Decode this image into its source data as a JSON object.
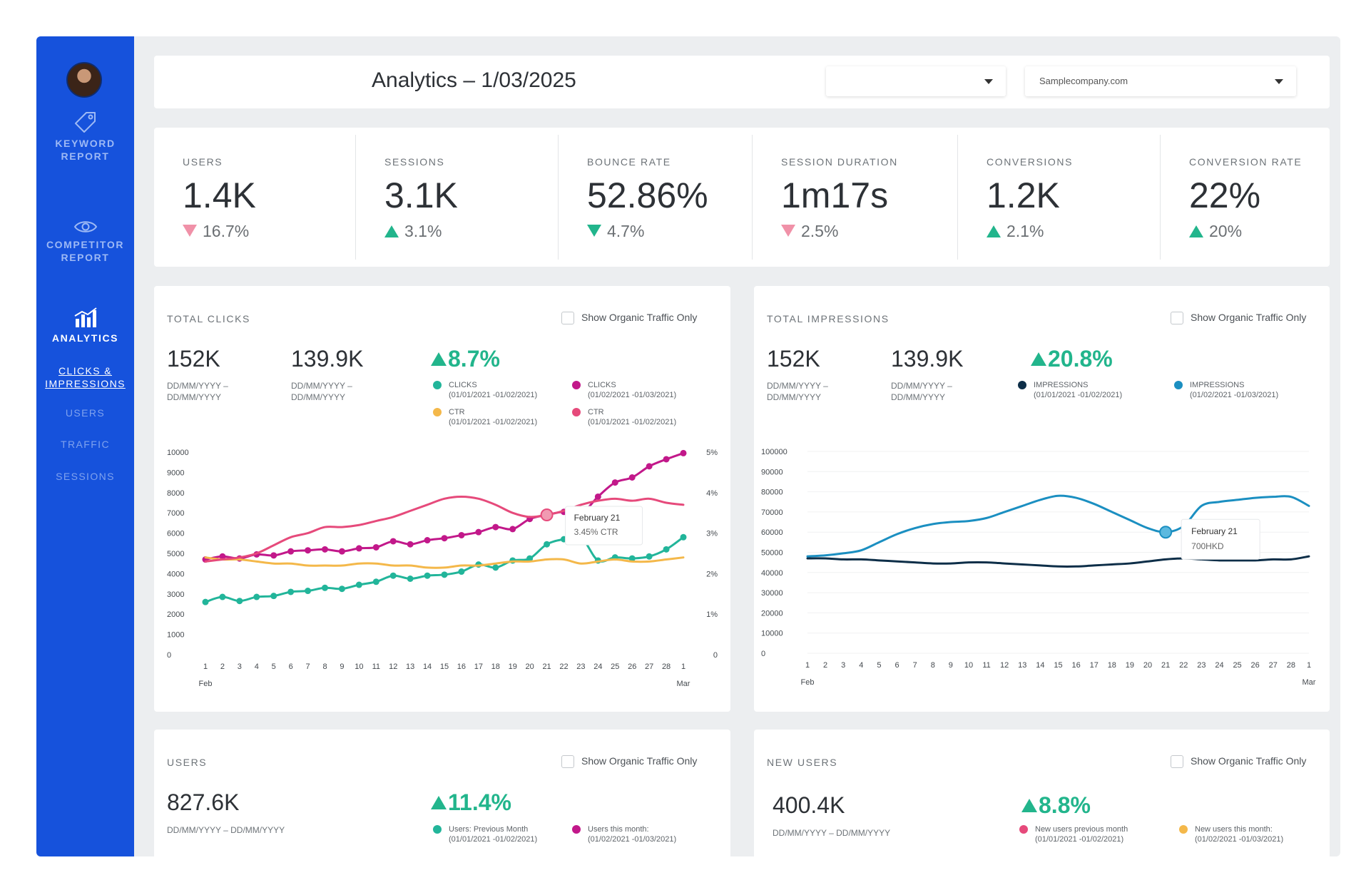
{
  "header": {
    "title": "Analytics – 1/03/2025",
    "select1_value": "",
    "select2_value": "Samplecompany.com"
  },
  "sidebar": {
    "items": [
      {
        "label": "KEYWORD REPORT",
        "icon": "tag-icon"
      },
      {
        "label": "COMPETITOR REPORT",
        "icon": "eye-icon"
      },
      {
        "label": "ANALYTICS",
        "icon": "bar-chart-icon",
        "active": true
      }
    ],
    "subitems": [
      {
        "label": "CLICKS & IMPRESSIONS",
        "active": true
      },
      {
        "label": "USERS"
      },
      {
        "label": "TRAFFIC"
      },
      {
        "label": "SESSIONS"
      }
    ]
  },
  "kpis": [
    {
      "label": "USERS",
      "value": "1.4K",
      "change": "16.7%",
      "direction": "down",
      "color": "#f091a8"
    },
    {
      "label": "SESSIONS",
      "value": "3.1K",
      "change": "3.1%",
      "direction": "up",
      "color": "#22b58c"
    },
    {
      "label": "BOUNCE RATE",
      "value": "52.86%",
      "change": "4.7%",
      "direction": "down",
      "color": "#22b58c"
    },
    {
      "label": "SESSION DURATION",
      "value": "1m17s",
      "change": "2.5%",
      "direction": "down",
      "color": "#f091a8"
    },
    {
      "label": "CONVERSIONS",
      "value": "1.2K",
      "change": "2.1%",
      "direction": "up",
      "color": "#22b58c"
    },
    {
      "label": "CONVERSION RATE",
      "value": "22%",
      "change": "20%",
      "direction": "up",
      "color": "#22b58c"
    }
  ],
  "organic_label": "Show Organic Traffic Only",
  "clicks_panel": {
    "title": "TOTAL CLICKS",
    "stat1": "152K",
    "stat1_range": [
      "DD/MM/YYYY –",
      "DD/MM/YYYY"
    ],
    "stat2": "139.9K",
    "stat2_range": [
      "DD/MM/YYYY –",
      "DD/MM/YYYY"
    ],
    "change": "8.7%",
    "legend": [
      {
        "name": "CLICKS",
        "range": "(01/01/2021 -01/02/2021)",
        "color": "#22b59a"
      },
      {
        "name": "CLICKS",
        "range": "(01/02/2021 -01/03/2021)",
        "color": "#c2188a"
      },
      {
        "name": "CTR",
        "range": "(01/01/2021 -01/02/2021)",
        "color": "#f4b84a"
      },
      {
        "name": "CTR",
        "range": "(01/01/2021 -01/02/2021)",
        "color": "#e64a7b"
      }
    ],
    "tooltip": {
      "title": "February 21",
      "value": "3.45% CTR"
    }
  },
  "impressions_panel": {
    "title": "TOTAL IMPRESSIONS",
    "stat1": "152K",
    "stat1_range": [
      "DD/MM/YYYY –",
      "DD/MM/YYYY"
    ],
    "stat2": "139.9K",
    "stat2_range": [
      "DD/MM/YYYY –",
      "DD/MM/YYYY"
    ],
    "change": "20.8%",
    "legend": [
      {
        "name": "IMPRESSIONS",
        "range": "(01/01/2021 -01/02/2021)",
        "color": "#0d2e48"
      },
      {
        "name": "IMPRESSIONS",
        "range": "(01/02/2021 -01/03/2021)",
        "color": "#1b8fc1"
      }
    ],
    "tooltip": {
      "title": "February 21",
      "value": "700HKD"
    }
  },
  "users_panel": {
    "title": "USERS",
    "stat": "827.6K",
    "stat_range": "DD/MM/YYYY – DD/MM/YYYY",
    "change": "11.4%",
    "legend": [
      {
        "name": "Users: Previous Month",
        "range": "(01/01/2021 -01/02/2021)",
        "color": "#22b59a"
      },
      {
        "name": "Users this month:",
        "range": "(01/02/2021 -01/03/2021)",
        "color": "#c2188a"
      }
    ]
  },
  "newusers_panel": {
    "title": "NEW USERS",
    "stat": "400.4K",
    "stat_range": "DD/MM/YYYY – DD/MM/YYYY",
    "change": "8.8%",
    "legend": [
      {
        "name": "New users previous month",
        "range": "(01/01/2021 -01/02/2021)",
        "color": "#e64a7b"
      },
      {
        "name": "New users this month:",
        "range": "(01/02/2021 -01/03/2021)",
        "color": "#f4b84a"
      }
    ]
  },
  "chart_data": [
    {
      "type": "line",
      "title": "TOTAL CLICKS",
      "x": [
        "1",
        "2",
        "3",
        "4",
        "5",
        "6",
        "7",
        "8",
        "9",
        "10",
        "11",
        "12",
        "13",
        "14",
        "15",
        "16",
        "17",
        "18",
        "19",
        "20",
        "21",
        "22",
        "23",
        "24",
        "25",
        "26",
        "27",
        "28",
        "1"
      ],
      "x_group_labels": [
        "Feb",
        "Mar"
      ],
      "ylim": [
        0,
        10000
      ],
      "y_ticks": [
        "0",
        "1000",
        "2000",
        "3000",
        "4000",
        "5000",
        "6000",
        "7000",
        "8000",
        "9000",
        "10000"
      ],
      "y2lim": [
        0,
        5
      ],
      "y2_ticks": [
        "0",
        "1%",
        "2%",
        "3%",
        "4%",
        "5%"
      ],
      "series": [
        {
          "axis": "left",
          "color": "#22b59a",
          "markers": true,
          "values": [
            2600,
            2850,
            2650,
            2850,
            2900,
            3100,
            3150,
            3300,
            3250,
            3450,
            3600,
            3900,
            3750,
            3900,
            3950,
            4100,
            4450,
            4300,
            4650,
            4750,
            5450,
            5700,
            5800,
            4650,
            4800,
            4750,
            4850,
            5200,
            5800
          ]
        },
        {
          "axis": "left",
          "color": "#c2188a",
          "markers": true,
          "values": [
            4700,
            4850,
            4750,
            4950,
            4900,
            5100,
            5150,
            5200,
            5100,
            5250,
            5300,
            5600,
            5450,
            5650,
            5750,
            5900,
            6050,
            6300,
            6200,
            6700,
            6900,
            7050,
            6950,
            7800,
            8500,
            8750,
            9300,
            9650,
            9950
          ]
        },
        {
          "axis": "right",
          "color": "#f4b84a",
          "markers": false,
          "values": [
            2.4,
            2.35,
            2.35,
            2.3,
            2.25,
            2.25,
            2.2,
            2.2,
            2.2,
            2.25,
            2.25,
            2.2,
            2.2,
            2.15,
            2.15,
            2.2,
            2.2,
            2.25,
            2.3,
            2.3,
            2.35,
            2.35,
            2.25,
            2.3,
            2.35,
            2.3,
            2.3,
            2.35,
            2.4
          ]
        },
        {
          "axis": "right",
          "color": "#e64a7b",
          "markers": false,
          "values": [
            2.3,
            2.35,
            2.4,
            2.5,
            2.7,
            2.9,
            3.0,
            3.15,
            3.15,
            3.2,
            3.3,
            3.4,
            3.55,
            3.7,
            3.85,
            3.9,
            3.85,
            3.7,
            3.5,
            3.4,
            3.45,
            3.55,
            3.7,
            3.8,
            3.85,
            3.8,
            3.85,
            3.75,
            3.7
          ]
        }
      ]
    },
    {
      "type": "line",
      "title": "TOTAL IMPRESSIONS",
      "x": [
        "1",
        "2",
        "3",
        "4",
        "5",
        "6",
        "7",
        "8",
        "9",
        "10",
        "11",
        "12",
        "13",
        "14",
        "15",
        "16",
        "17",
        "18",
        "19",
        "20",
        "21",
        "22",
        "23",
        "24",
        "25",
        "26",
        "27",
        "28",
        "1"
      ],
      "x_group_labels": [
        "Feb",
        "Mar"
      ],
      "ylim": [
        0,
        100000
      ],
      "y_ticks": [
        "0",
        "10000",
        "20000",
        "30000",
        "40000",
        "50000",
        "60000",
        "70000",
        "80000",
        "90000",
        "100000"
      ],
      "series": [
        {
          "color": "#0d2e48",
          "values": [
            47000,
            47000,
            46500,
            46500,
            46000,
            45500,
            45000,
            44500,
            44500,
            45000,
            45000,
            44500,
            44000,
            43500,
            43000,
            43000,
            43500,
            44000,
            44500,
            45500,
            46500,
            47000,
            46500,
            46000,
            46000,
            46000,
            46500,
            46500,
            48000
          ]
        },
        {
          "color": "#1b8fc1",
          "values": [
            48000,
            48500,
            49500,
            51000,
            55000,
            59000,
            62000,
            64000,
            65000,
            65500,
            67000,
            70000,
            73000,
            76000,
            78000,
            77000,
            74000,
            70000,
            66000,
            62000,
            60000,
            63000,
            73000,
            75000,
            76000,
            77000,
            77500,
            77500,
            73000
          ]
        }
      ]
    }
  ]
}
